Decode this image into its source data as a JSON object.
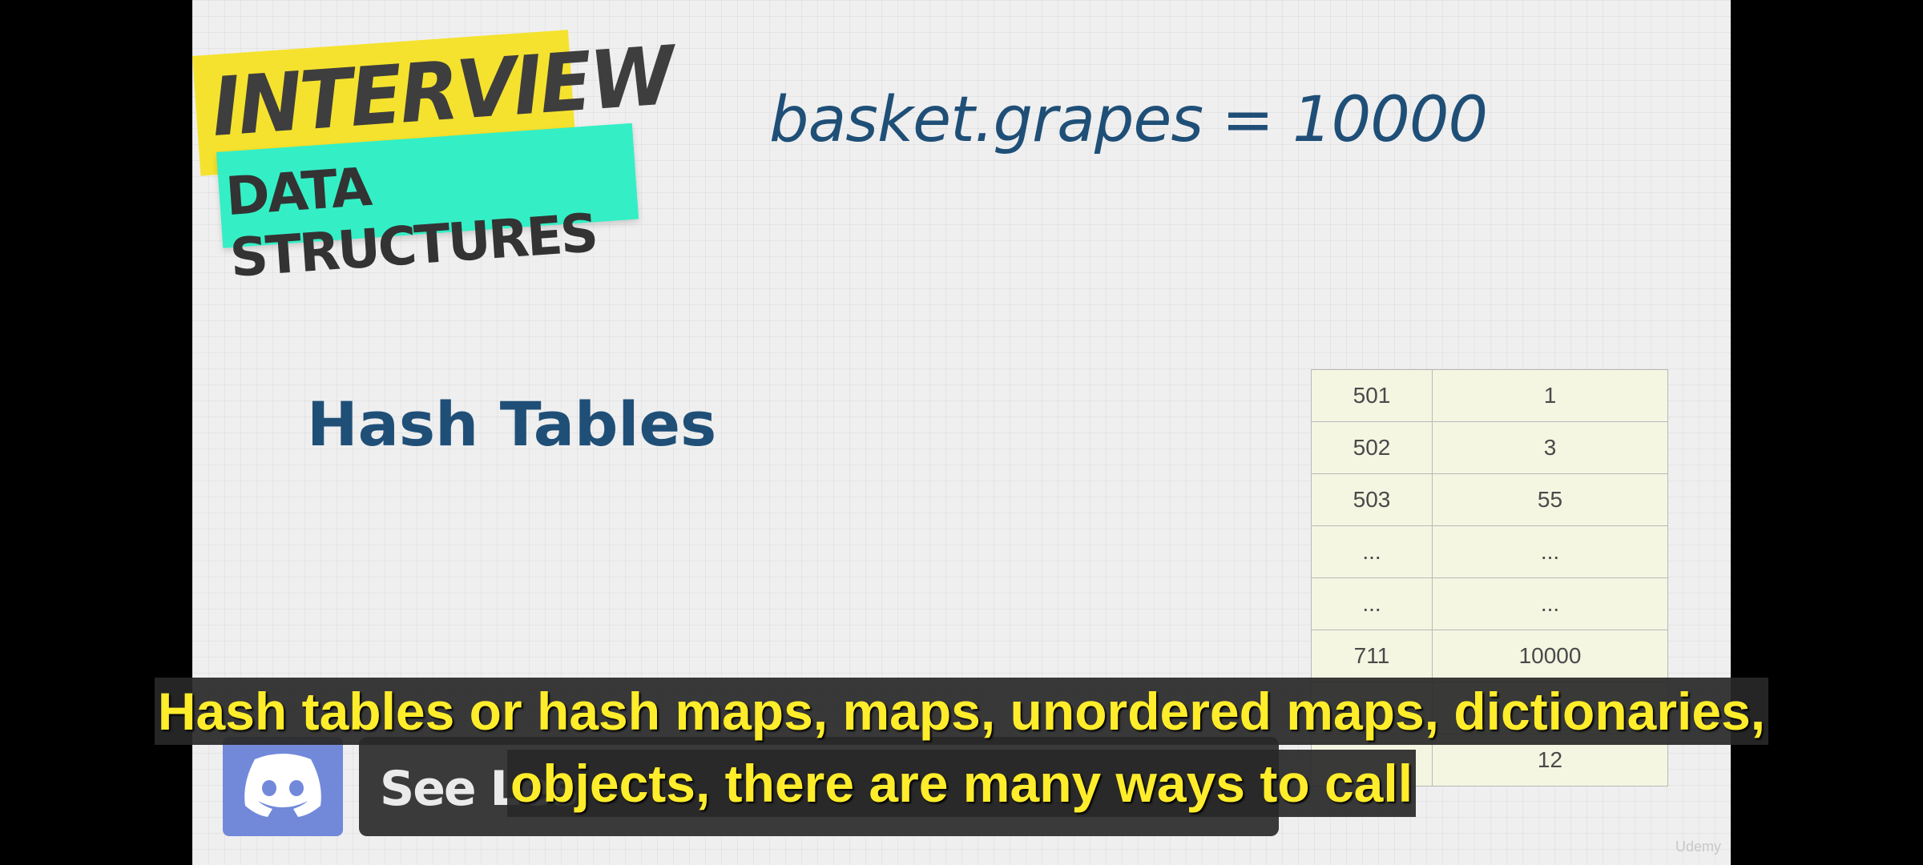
{
  "badge": {
    "line1": "INTERVIEW",
    "line2": "DATA STRUCTURES",
    "colors": {
      "yellow": "#f5e22e",
      "teal": "#34efc5"
    }
  },
  "slide": {
    "code": "basket.grapes = 10000",
    "heading": "Hash Tables",
    "title_color": "#1f4f77"
  },
  "memory_table": {
    "rows": [
      {
        "address": "501",
        "value": "1"
      },
      {
        "address": "502",
        "value": "3"
      },
      {
        "address": "503",
        "value": "55"
      },
      {
        "address": "...",
        "value": "..."
      },
      {
        "address": "...",
        "value": "..."
      },
      {
        "address": "711",
        "value": "10000"
      },
      {
        "address": "",
        "value": ""
      },
      {
        "address": "",
        "value": "12"
      }
    ]
  },
  "discord": {
    "icon": "discord-icon",
    "text": "See Les"
  },
  "watermark": "Udemy",
  "captions": {
    "line1": "Hash tables or hash maps, maps, unordered maps, dictionaries,",
    "line2": "objects, there are many ways to call"
  }
}
